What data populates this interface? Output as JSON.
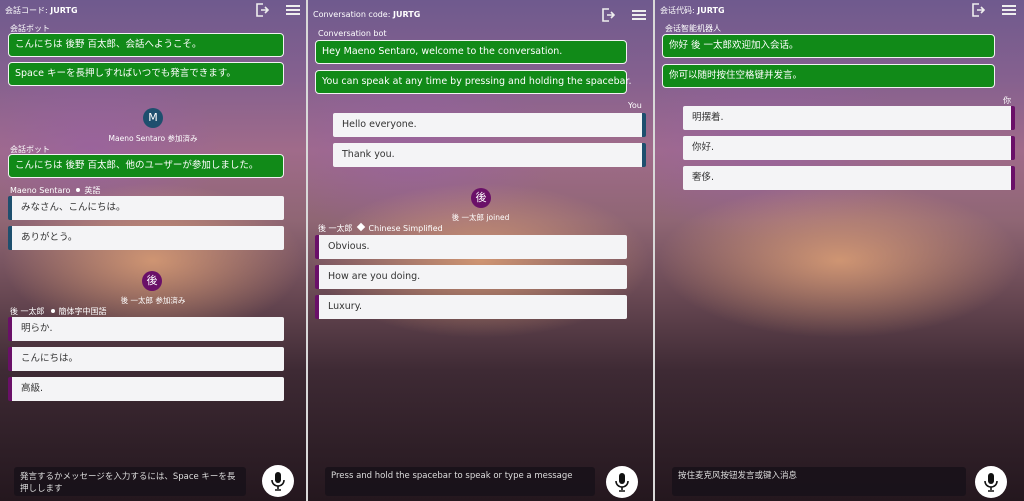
{
  "panel1": {
    "conv_code_label": "会話コード:",
    "conv_code": "JURTG",
    "bot_name": "会話ボット",
    "bot_messages": [
      "こんにちは 後野 百太郎、会話へようこそ。",
      "Space キーを長押しすればいつでも発言できます。"
    ],
    "avatar_m": "M",
    "joined_m": "Maeno Sentaro 参加済み",
    "bot_name_2": "会話ボット",
    "bot_message_2": "こんにちは 後野 百太郎、他のユーザーが参加しました。",
    "sender_m_name": "Maeno Sentaro",
    "sender_m_lang": "英語",
    "m_messages": [
      "みなさん、こんにちは。",
      "ありがとう。"
    ],
    "avatar_u": "後",
    "joined_u": "後 一太郎 参加済み",
    "sender_u_name": "後 一太郎",
    "sender_u_lang": "簡体字中国語",
    "u_messages": [
      "明らか.",
      "こんにちは。",
      "高級."
    ],
    "input_placeholder": "発言するかメッセージを入力するには、Space キーを長押しします"
  },
  "panel2": {
    "conv_code_label": "Conversation code:",
    "conv_code": "JURTG",
    "bot_name": "Conversation bot",
    "bot_messages": [
      "Hey Maeno Sentaro, welcome to the conversation.",
      "You can speak at any time by pressing and holding the spacebar."
    ],
    "you_label": "You",
    "my_messages": [
      "Hello everyone.",
      "Thank you."
    ],
    "avatar_u": "後",
    "joined_u": "後 一太郎 joined",
    "sender_u_name": "後 一太郎",
    "sender_u_lang": "Chinese Simplified",
    "u_messages": [
      "Obvious.",
      "How are you doing.",
      "Luxury."
    ],
    "input_placeholder": "Press and hold the spacebar to speak or type a message"
  },
  "panel3": {
    "conv_code_label": "会话代码:",
    "conv_code": "JURTG",
    "bot_name": "会话智能机器人",
    "bot_messages": [
      "你好 後 一太郎欢迎加入会话。",
      "你可以随时按住空格键并发言。"
    ],
    "you_label": "你",
    "my_messages": [
      "明摆着.",
      "你好.",
      "奢侈."
    ],
    "input_placeholder": "按住麦克风按钮发言或键入消息"
  },
  "colors": {
    "bot_bubble": "#118a18",
    "user_blue": "#1e4f6e",
    "user_purple": "#6a1068"
  },
  "icons": [
    "exit-icon",
    "hamburger-menu-icon",
    "microphone-icon"
  ]
}
